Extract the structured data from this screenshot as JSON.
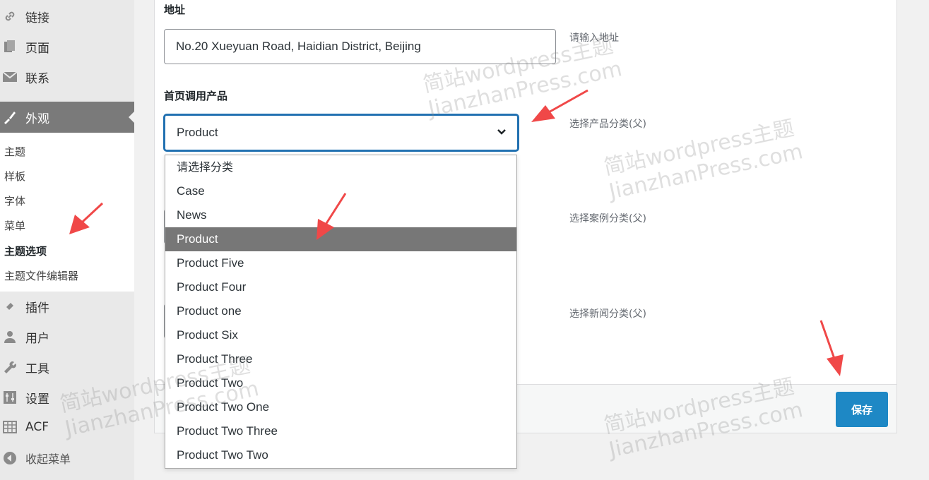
{
  "sidebar": {
    "items_top": [
      {
        "label": "链接",
        "icon": "link-icon"
      },
      {
        "label": "页面",
        "icon": "pages-icon"
      },
      {
        "label": "联系",
        "icon": "mail-icon"
      }
    ],
    "active": {
      "label": "外观",
      "icon": "paintbrush-icon"
    },
    "submenu": [
      "主题",
      "样板",
      "字体",
      "菜单",
      "主题选项",
      "主题文件编辑器"
    ],
    "items_bottom": [
      {
        "label": "插件",
        "icon": "plugin-icon"
      },
      {
        "label": "用户",
        "icon": "user-icon"
      },
      {
        "label": "工具",
        "icon": "wrench-icon"
      },
      {
        "label": "设置",
        "icon": "settings-icon"
      },
      {
        "label": "ACF",
        "icon": "table-icon"
      },
      {
        "label": "收起菜单",
        "icon": "collapse-icon"
      }
    ]
  },
  "form": {
    "address_label": "地址",
    "address_value": "No.20 Xueyuan Road, Haidian District, Beijing",
    "address_hint": "请输入地址",
    "home_products_label": "首页调用产品",
    "product_select_value": "Product",
    "product_hint": "选择产品分类(父)",
    "case_hint": "选择案例分类(父)",
    "news_hint": "选择新闻分类(父)",
    "save_label": "保存"
  },
  "dropdown_options": [
    "请选择分类",
    "Case",
    "News",
    "Product",
    "Product Five",
    "Product Four",
    "Product one",
    "Product Six",
    "Product Three",
    "Product Two",
    "Product Two One",
    "Product Two Three",
    "Product Two Two"
  ],
  "dropdown_selected_index": 3,
  "watermark": {
    "line1": "简站wordpress主题",
    "line2": "JianzhanPress.com"
  },
  "colors": {
    "accent": "#2271b1",
    "save_button": "#1e88c5",
    "arrow": "#f04848",
    "active_menu": "#7a7a7a"
  }
}
